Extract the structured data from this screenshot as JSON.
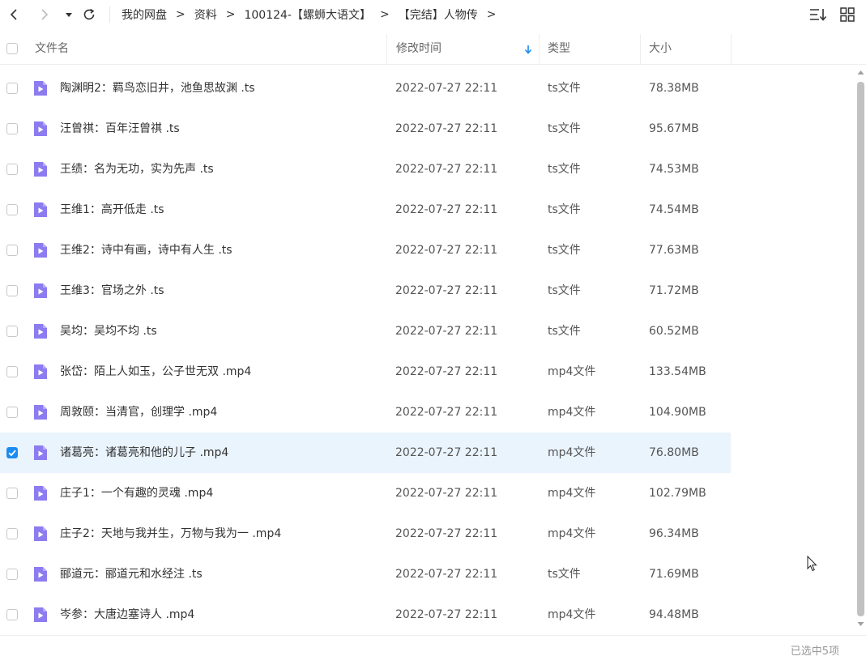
{
  "breadcrumb": [
    "我的网盘",
    "资料",
    "100124-【螺蛳大语文】",
    "【完结】人物传"
  ],
  "header": {
    "name": "文件名",
    "time": "修改时间",
    "type": "类型",
    "size": "大小"
  },
  "files": [
    {
      "name": "陶渊明2：羁鸟恋旧井，池鱼思故渊 .ts",
      "time": "2022-07-27 22:11",
      "type": "ts文件",
      "size": "78.38MB",
      "checked": false
    },
    {
      "name": "汪曾祺：百年汪曾祺 .ts",
      "time": "2022-07-27 22:11",
      "type": "ts文件",
      "size": "95.67MB",
      "checked": false
    },
    {
      "name": "王绩：名为无功，实为先声 .ts",
      "time": "2022-07-27 22:11",
      "type": "ts文件",
      "size": "74.53MB",
      "checked": false
    },
    {
      "name": "王维1：高开低走 .ts",
      "time": "2022-07-27 22:11",
      "type": "ts文件",
      "size": "74.54MB",
      "checked": false
    },
    {
      "name": "王维2：诗中有画，诗中有人生 .ts",
      "time": "2022-07-27 22:11",
      "type": "ts文件",
      "size": "77.63MB",
      "checked": false
    },
    {
      "name": "王维3：官场之外 .ts",
      "time": "2022-07-27 22:11",
      "type": "ts文件",
      "size": "71.72MB",
      "checked": false
    },
    {
      "name": "吴均：吴均不均 .ts",
      "time": "2022-07-27 22:11",
      "type": "ts文件",
      "size": "60.52MB",
      "checked": false
    },
    {
      "name": "张岱：陌上人如玉，公子世无双 .mp4",
      "time": "2022-07-27 22:11",
      "type": "mp4文件",
      "size": "133.54MB",
      "checked": false
    },
    {
      "name": "周敦颐：当清官，创理学 .mp4",
      "time": "2022-07-27 22:11",
      "type": "mp4文件",
      "size": "104.90MB",
      "checked": false
    },
    {
      "name": "诸葛亮：诸葛亮和他的儿子 .mp4",
      "time": "2022-07-27 22:11",
      "type": "mp4文件",
      "size": "76.80MB",
      "checked": true
    },
    {
      "name": "庄子1：一个有趣的灵魂 .mp4",
      "time": "2022-07-27 22:11",
      "type": "mp4文件",
      "size": "102.79MB",
      "checked": false
    },
    {
      "name": "庄子2：天地与我并生，万物与我为一 .mp4",
      "time": "2022-07-27 22:11",
      "type": "mp4文件",
      "size": "96.34MB",
      "checked": false
    },
    {
      "name": "郦道元：郦道元和水经注 .ts",
      "time": "2022-07-27 22:11",
      "type": "ts文件",
      "size": "71.69MB",
      "checked": false
    },
    {
      "name": "岑参：大唐边塞诗人 .mp4",
      "time": "2022-07-27 22:11",
      "type": "mp4文件",
      "size": "94.48MB",
      "checked": false
    }
  ],
  "footer": {
    "status": "已选中5项"
  },
  "colors": {
    "accent": "#1c8cf0",
    "selected_row": "#eaf4fd",
    "file_icon": "#8c7cf0"
  }
}
